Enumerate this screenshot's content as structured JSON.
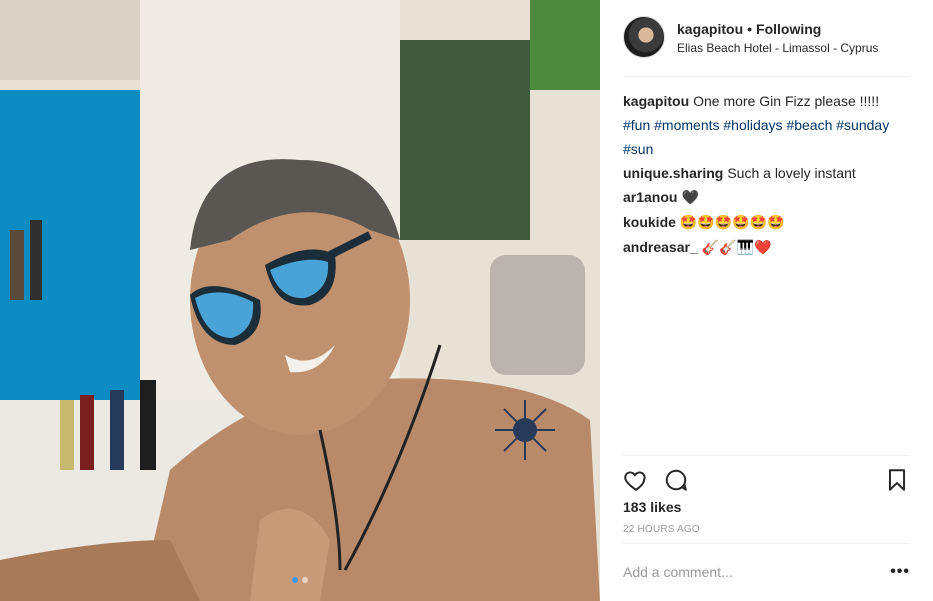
{
  "post": {
    "username": "kagapitou",
    "separator": "•",
    "follow_status": "Following",
    "location": "Elias Beach Hotel - Limassol - Cyprus"
  },
  "comments": [
    {
      "user": "kagapitou",
      "text": "One more Gin Fizz please !!!!! ",
      "tags": [
        "#fun",
        "#moments",
        "#holidays",
        "#beach",
        "#sunday",
        "#sun"
      ]
    },
    {
      "user": "unique.sharing",
      "text": "Such a lovely instant"
    },
    {
      "user": "ar1anou",
      "text": "🖤"
    },
    {
      "user": "koukide",
      "text": "🤩🤩🤩🤩🤩🤩"
    },
    {
      "user": "andreasar_",
      "text": "🎸🎸🎹❤️"
    }
  ],
  "likes": "183 likes",
  "time": "22 HOURS AGO",
  "add_comment_placeholder": "Add a comment...",
  "more_label": "•••",
  "carousel": {
    "count": 2,
    "active": 0
  },
  "colors": {
    "link": "#003569",
    "accent": "#3897f0",
    "muted": "#999999"
  },
  "icons": {
    "like": "heart-icon",
    "comment": "comment-bubble-icon",
    "save": "bookmark-icon",
    "options": "more-options-icon"
  }
}
